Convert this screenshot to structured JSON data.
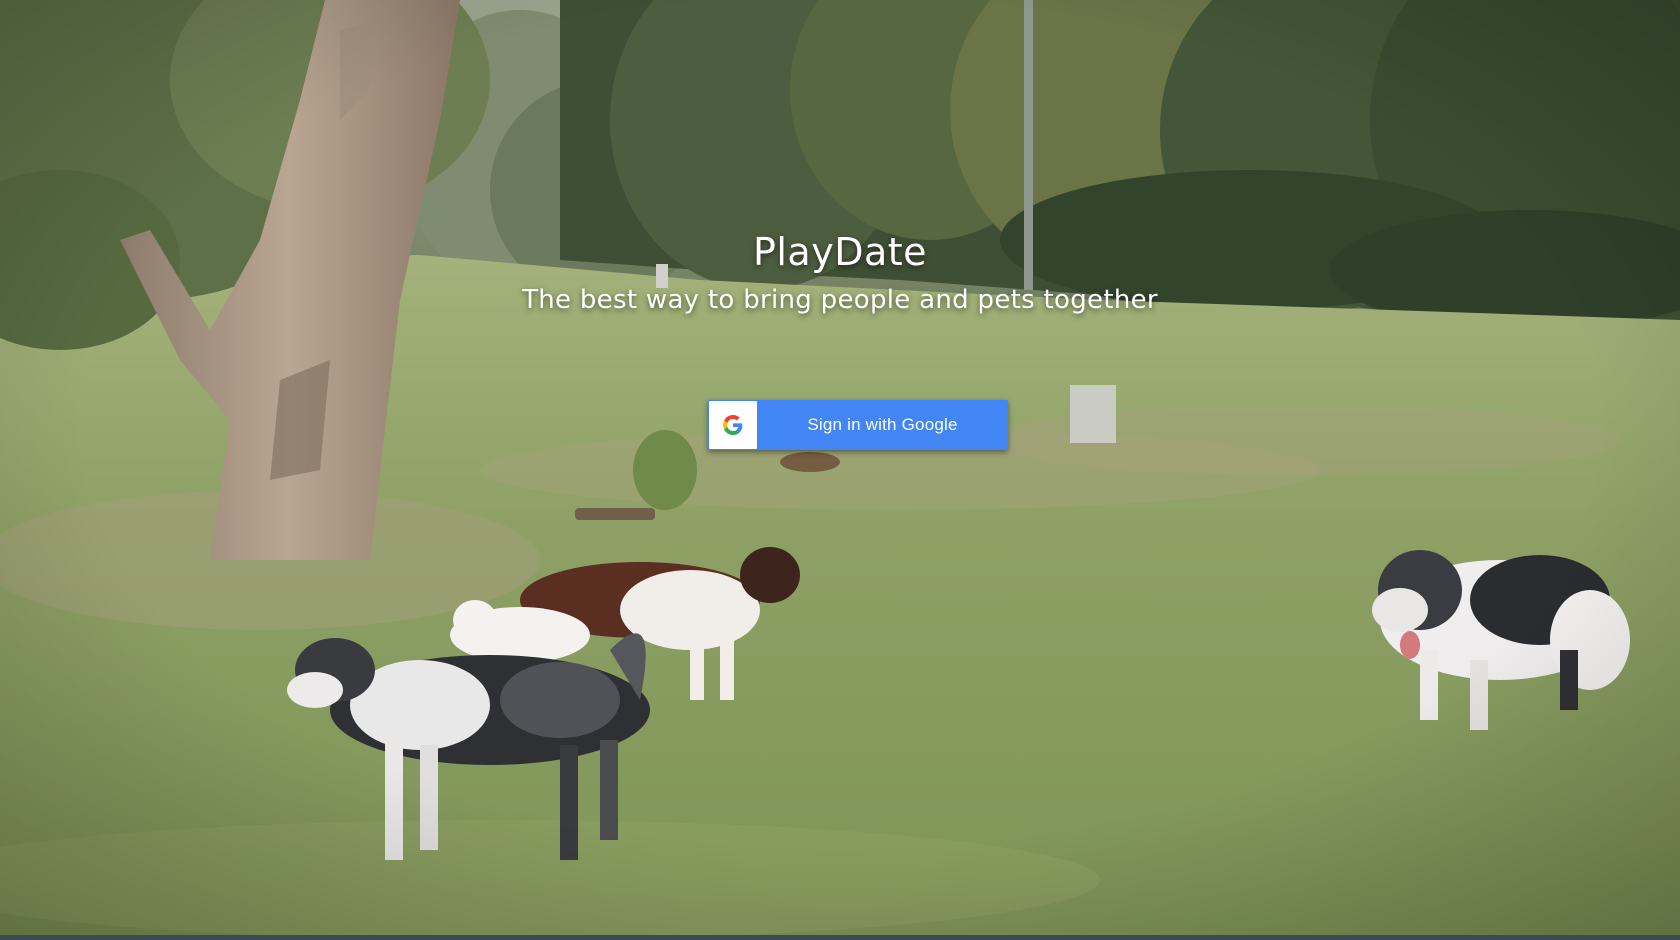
{
  "app": {
    "title": "PlayDate",
    "tagline": "The best way to bring people and pets together"
  },
  "signin": {
    "label": "Sign in with Google",
    "icon": "google-g-icon",
    "color": "#4285f4"
  },
  "background": {
    "description_icon": "park-photo-background"
  }
}
